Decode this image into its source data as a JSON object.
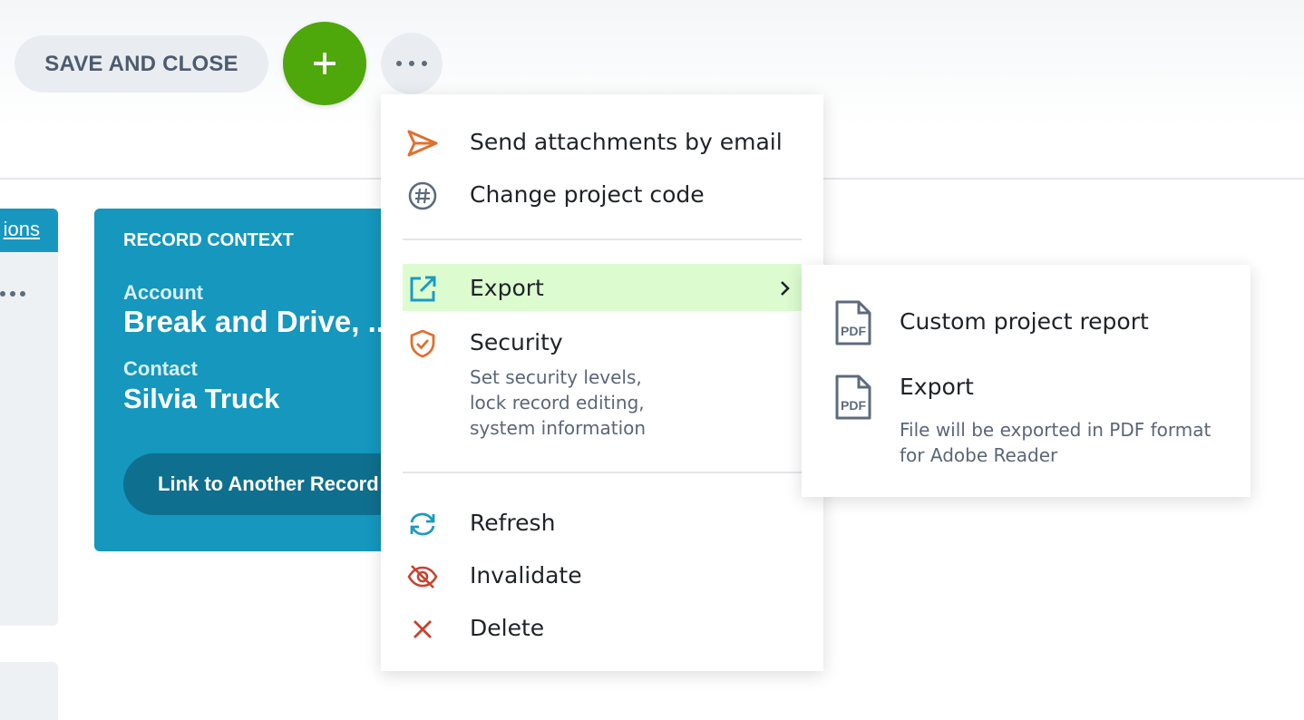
{
  "toolbar": {
    "save_close_label": "SAVE AND CLOSE",
    "add_symbol": "+",
    "more_symbol": "···"
  },
  "left_panel": {
    "link_fragment": "ions"
  },
  "record_context": {
    "title": "RECORD CONTEXT",
    "account_label": "Account",
    "account_value": "Break and Drive, ...",
    "contact_label": "Contact",
    "contact_value": "Silvia Truck",
    "link_button_label": "Link to Another Record"
  },
  "menu": {
    "items": [
      {
        "label": "Send attachments by email",
        "icon": "send-icon"
      },
      {
        "label": "Change project code",
        "icon": "hash-icon"
      },
      {
        "label": "Export",
        "icon": "external-link-icon",
        "active": true
      },
      {
        "label": "Security",
        "icon": "shield-check-icon",
        "description": [
          "Set security levels,",
          "lock record editing,",
          "system information"
        ]
      },
      {
        "label": "Refresh",
        "icon": "refresh-icon"
      },
      {
        "label": "Invalidate",
        "icon": "eye-off-icon"
      },
      {
        "label": "Delete",
        "icon": "close-icon"
      }
    ]
  },
  "submenu": {
    "items": [
      {
        "label": "Custom project report",
        "icon": "pdf-file-icon",
        "icon_text": "PDF"
      },
      {
        "label": "Export",
        "icon": "pdf-file-icon",
        "icon_text": "PDF",
        "description": [
          "File will be exported in PDF format",
          "for Adobe Reader"
        ]
      }
    ]
  },
  "colors": {
    "accent_green": "#4ea70b",
    "card_blue": "#1597be",
    "active_highlight": "#dcfcd0",
    "orange_icon": "#e0702e",
    "red_icon": "#c8432f",
    "teal_icon": "#1b9bc4"
  }
}
